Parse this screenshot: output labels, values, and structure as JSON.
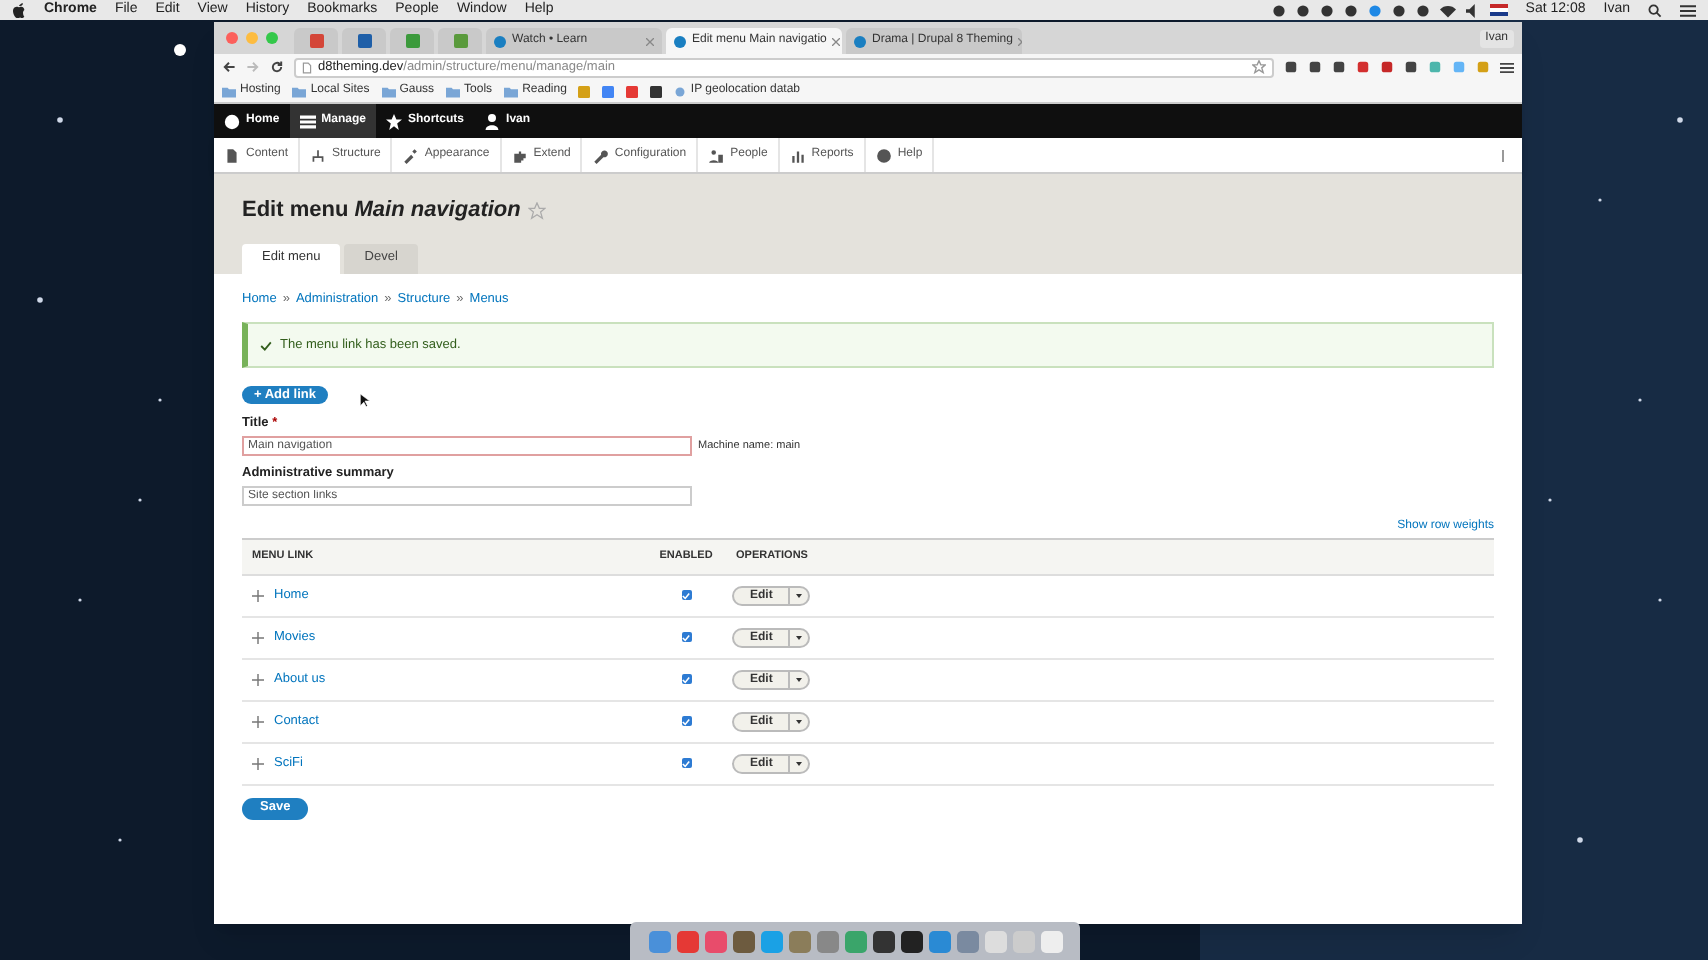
{
  "menu_bar": {
    "app": "Chrome",
    "menus": [
      "File",
      "Edit",
      "View",
      "History",
      "Bookmarks",
      "People",
      "Window",
      "Help"
    ],
    "clock": "Sat 12:08",
    "user": "Ivan"
  },
  "browser": {
    "tabs": [
      {
        "kind": "icon",
        "color": "#d44638",
        "selected": false
      },
      {
        "kind": "icon",
        "color": "#1f5fa8",
        "selected": false
      },
      {
        "kind": "icon",
        "color": "#3c9a3c",
        "selected": false
      },
      {
        "kind": "icon",
        "color": "#5a9a3c",
        "selected": false
      },
      {
        "kind": "text",
        "label": "Watch • Learn",
        "selected": false
      },
      {
        "kind": "text",
        "label": "Edit menu Main navigatio",
        "selected": true
      },
      {
        "kind": "text",
        "label": "Drama | Drupal 8 Theming",
        "selected": false
      }
    ],
    "profile": "Ivan",
    "url_host": "d8theming.dev",
    "url_path": "/admin/structure/menu/manage/main",
    "bookmarks": [
      {
        "kind": "folder",
        "label": "Hosting"
      },
      {
        "kind": "folder",
        "label": "Local Sites"
      },
      {
        "kind": "folder",
        "label": "Gauss"
      },
      {
        "kind": "folder",
        "label": "Tools"
      },
      {
        "kind": "folder",
        "label": "Reading"
      },
      {
        "kind": "link",
        "label": "IP geolocation datab"
      }
    ]
  },
  "toolbar": {
    "items": [
      {
        "label": "Home",
        "selected": false
      },
      {
        "label": "Manage",
        "selected": true
      },
      {
        "label": "Shortcuts",
        "selected": false
      },
      {
        "label": "Ivan",
        "selected": false
      }
    ],
    "tray": [
      "Content",
      "Structure",
      "Appearance",
      "Extend",
      "Configuration",
      "People",
      "Reports",
      "Help"
    ]
  },
  "page": {
    "title": "Edit menu",
    "title_name": "Main navigation",
    "tabs": [
      {
        "label": "Edit menu",
        "selected": true
      },
      {
        "label": "Devel",
        "selected": false
      }
    ],
    "breadcrumb": [
      "Home",
      "Administration",
      "Structure",
      "Menus"
    ],
    "breadcrumb_separator": "»",
    "message": "The menu link has been saved.",
    "add_link": "+ Add link",
    "title_field": {
      "label": "Title",
      "required": "*",
      "value": "Main navigation",
      "machine_name": "Machine name: main"
    },
    "summary_field": {
      "label": "Administrative summary",
      "value": "Site section links"
    },
    "show_row_weights": "Show row weights",
    "columns": [
      "MENU LINK",
      "ENABLED",
      "OPERATIONS"
    ],
    "rows": [
      {
        "label": "Home",
        "enabled": true,
        "operation": "Edit"
      },
      {
        "label": "Movies",
        "enabled": true,
        "operation": "Edit"
      },
      {
        "label": "About us",
        "enabled": true,
        "operation": "Edit"
      },
      {
        "label": "Contact",
        "enabled": true,
        "operation": "Edit"
      },
      {
        "label": "SciFi",
        "enabled": true,
        "operation": "Edit"
      }
    ],
    "save": "Save"
  }
}
